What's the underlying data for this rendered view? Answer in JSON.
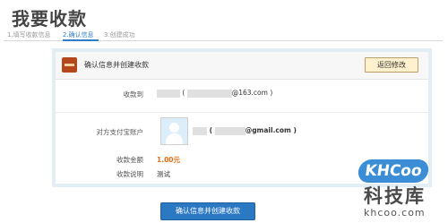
{
  "page": {
    "title": "我要收款"
  },
  "steps": {
    "step1": "1.填写收款信息",
    "step2": "2.确认信息",
    "step3": "3.创建成功"
  },
  "card": {
    "header_text": "确认信息并创建收款",
    "back_button": "返回修改",
    "payee_label": "收款到",
    "payee_value_open": "(",
    "payee_value_suffix": "@163.com )",
    "payer_label": "对方支付宝账户",
    "payer_value_open": "(",
    "payer_value_suffix": "@gmail.com )",
    "amount_label": "收款金额",
    "amount_value": "1.00元",
    "note_label": "收款说明",
    "note_value": "测试"
  },
  "submit_button": "确认信息并创建收款",
  "watermark": {
    "badge": "KHCoo",
    "name": "科技库",
    "domain": "khcoo.com"
  }
}
